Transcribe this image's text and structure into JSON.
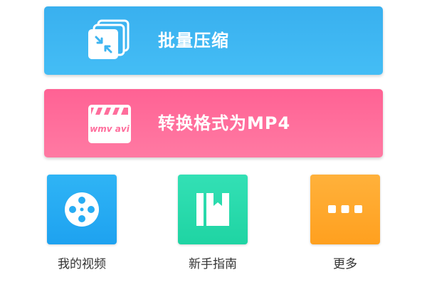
{
  "cards": {
    "compress": {
      "label": "批量压缩",
      "icon": "compress-stack-icon",
      "color": "#3fb5f2"
    },
    "convert": {
      "label": "转换格式为MP4",
      "icon": "clapperboard-icon",
      "icon_text": "wmv avi",
      "color": "#ff6d9c"
    }
  },
  "tiles": [
    {
      "label": "我的视频",
      "icon": "film-reel-icon",
      "color": "#27acf3"
    },
    {
      "label": "新手指南",
      "icon": "book-icon",
      "color": "#26d9aa"
    },
    {
      "label": "更多",
      "icon": "more-dots-icon",
      "color": "#ffa92c"
    }
  ]
}
